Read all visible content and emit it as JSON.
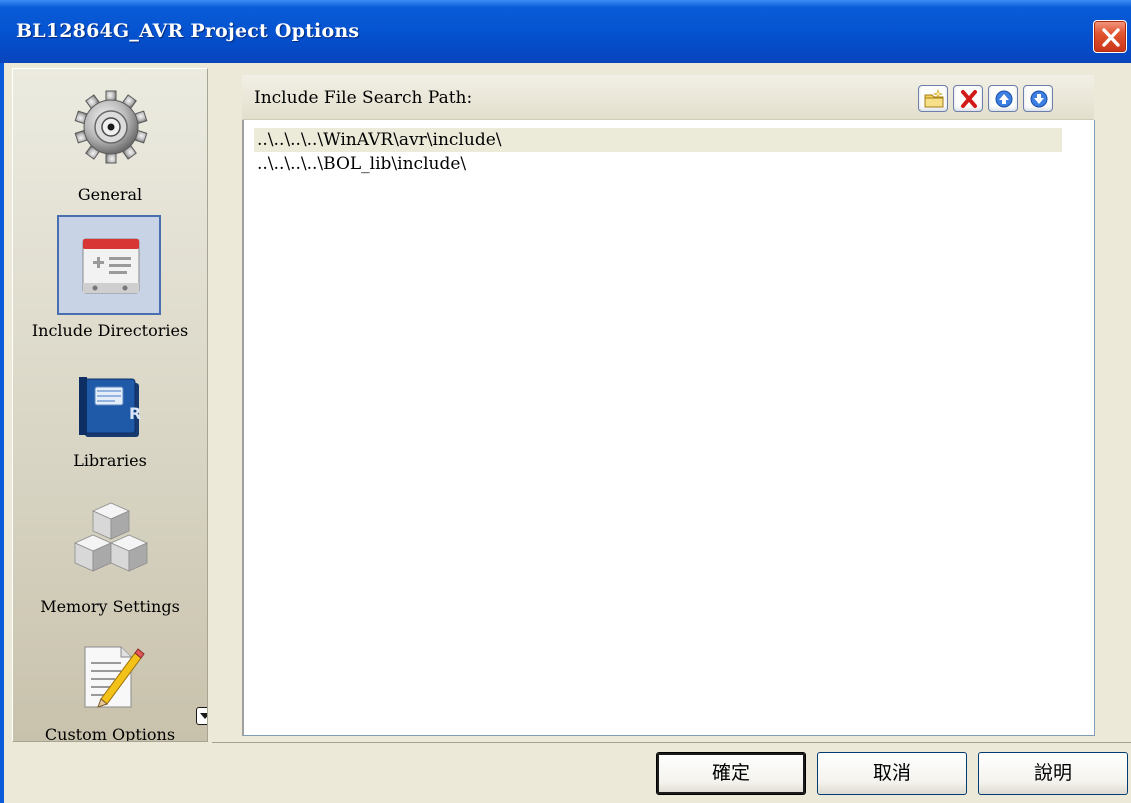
{
  "window": {
    "title": "BL12864G_AVR Project Options"
  },
  "nav": {
    "items": [
      {
        "label": "General",
        "icon": "gear-icon",
        "selected": false
      },
      {
        "label": "Include Directories",
        "icon": "include-directories-icon",
        "selected": true
      },
      {
        "label": "Libraries",
        "icon": "libraries-book-icon",
        "selected": false
      },
      {
        "label": "Memory Settings",
        "icon": "memory-cubes-icon",
        "selected": false
      },
      {
        "label": "Custom Options",
        "icon": "notepad-pencil-icon",
        "selected": false
      }
    ]
  },
  "panel": {
    "header_label": "Include File Search Path:",
    "toolbar": [
      "new-folder-icon",
      "delete-icon",
      "move-up-icon",
      "move-down-icon"
    ],
    "paths": [
      "..\\..\\..\\..\\WinAVR\\avr\\include\\",
      "..\\..\\..\\..\\BOL_lib\\include\\"
    ],
    "selected_index": 0
  },
  "buttons": {
    "ok": "確定",
    "cancel": "取消",
    "help": "說明"
  }
}
